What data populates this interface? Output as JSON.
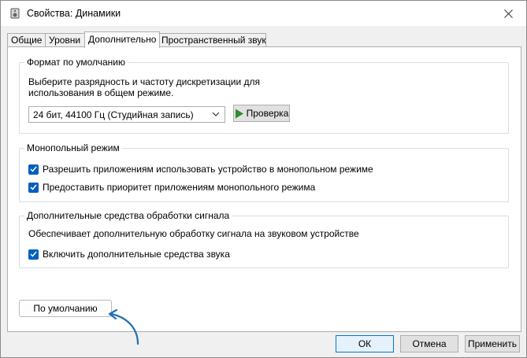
{
  "window": {
    "title": "Свойства: Динамики"
  },
  "tabs": [
    {
      "label": "Общие"
    },
    {
      "label": "Уровни"
    },
    {
      "label": "Дополнительно"
    },
    {
      "label": "Пространственный звук"
    }
  ],
  "format_group": {
    "title": "Формат по умолчанию",
    "description_line1": "Выберите разрядность и частоту дискретизации для",
    "description_line2": "использования в общем режиме.",
    "selected_format": "24 бит, 44100 Гц (Студийная запись)",
    "test_button": "Проверка"
  },
  "exclusive_group": {
    "title": "Монопольный режим",
    "allow_exclusive": "Разрешить приложениям использовать устройство в монопольном режиме",
    "priority_exclusive": "Предоставить приоритет приложениям монопольного режима"
  },
  "enhancements_group": {
    "title": "Дополнительные средства обработки сигнала",
    "description": "Обеспечивает дополнительную обработку сигнала на звуковом устройстве",
    "enable_enhancements": "Включить дополнительные средства звука"
  },
  "restore_defaults_button": "По умолчанию",
  "footer": {
    "ok": "ОК",
    "cancel": "Отмена",
    "apply": "Применить"
  },
  "checkbox_states": {
    "allow_exclusive": true,
    "priority_exclusive": true,
    "enable_enhancements": true
  },
  "colors": {
    "checkbox": "#0060c0",
    "play_icon": "#2e8b2e",
    "annotation_arrow": "#1f6fb5"
  }
}
